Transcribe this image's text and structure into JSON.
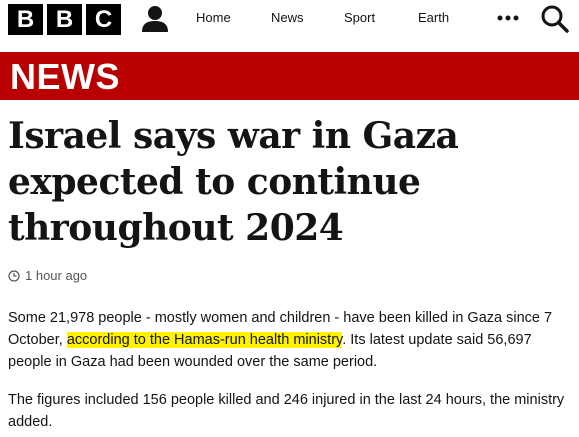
{
  "header": {
    "logo_letters": [
      "B",
      "B",
      "C"
    ],
    "account_icon": "person-icon",
    "nav": [
      {
        "label": "Home"
      },
      {
        "label": "News"
      },
      {
        "label": "Sport"
      },
      {
        "label": "Earth"
      }
    ],
    "more_icon": "more-dots-icon",
    "search_icon": "search-icon"
  },
  "banner": {
    "label": "NEWS",
    "color": "#b80000"
  },
  "article": {
    "headline": "Israel says war in Gaza expected to continue throughout 2024",
    "timestamp": "1 hour ago",
    "paragraph1": {
      "before": "Some 21,978 people - mostly women and children - have been killed in Gaza since 7 October, ",
      "link": "according to the Hamas-run health ministry",
      "after": ". Its latest update said 56,697 people in Gaza had been wounded over the same period."
    },
    "paragraph2": "The figures included 156 people killed and 246 injured in the last 24 hours, the ministry added.",
    "highlight_color": "#fff200"
  }
}
